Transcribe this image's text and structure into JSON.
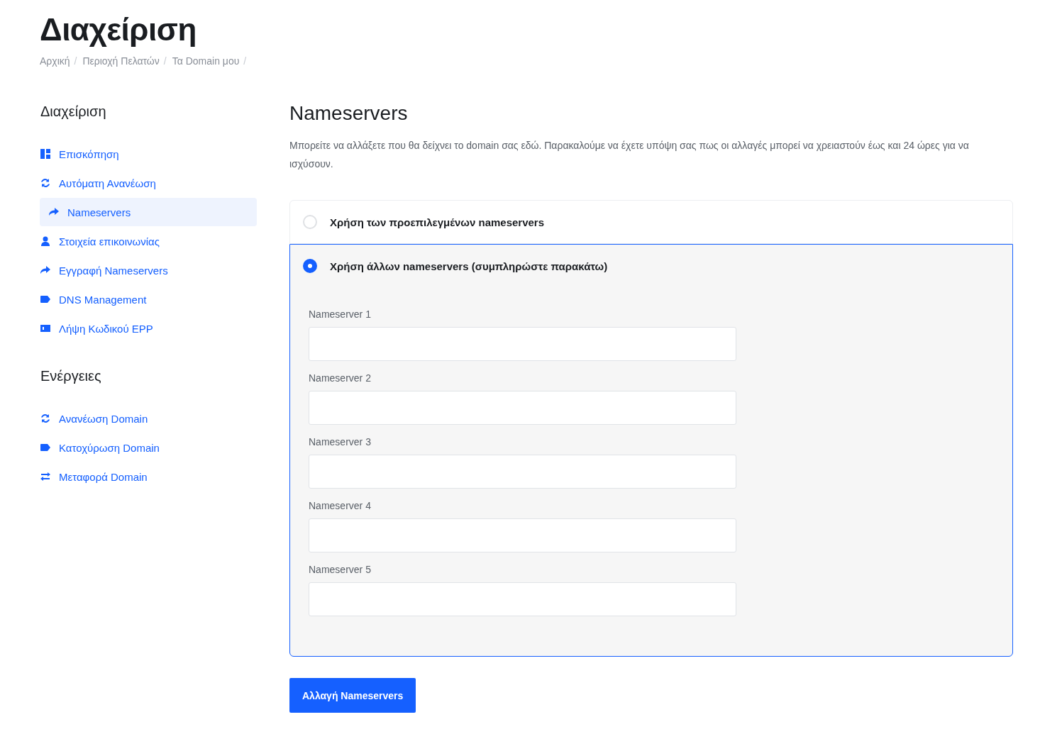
{
  "page_title": "Διαχείριση",
  "breadcrumb": [
    {
      "label": "Αρχική",
      "separator": "/"
    },
    {
      "label": "Περιοχή Πελατών",
      "separator": "/"
    },
    {
      "label": "Τα Domain μου",
      "separator": "/"
    }
  ],
  "sidebar": [
    {
      "heading": "Διαχείριση",
      "items": [
        {
          "label": "Επισκόπηση",
          "kind": "dashboard",
          "selected": false
        },
        {
          "label": "Αυτόματη Ανανέωση",
          "kind": "refresh",
          "selected": false
        },
        {
          "label": "Nameservers",
          "kind": "share",
          "selected": true
        },
        {
          "label": "Στοιχεία επικοινωνίας",
          "kind": "user",
          "selected": false
        },
        {
          "label": "Εγγραφή Nameservers",
          "kind": "share",
          "selected": false
        },
        {
          "label": "DNS Management",
          "kind": "tag",
          "selected": false
        },
        {
          "label": "Λήψη Κωδικού EPP",
          "kind": "card",
          "selected": false
        }
      ]
    },
    {
      "heading": "Ενέργειες",
      "items": [
        {
          "label": "Ανανέωση Domain",
          "kind": "refresh",
          "selected": false
        },
        {
          "label": "Κατοχύρωση Domain",
          "kind": "tag",
          "selected": false
        },
        {
          "label": "Μεταφορά Domain",
          "kind": "transfer",
          "selected": false
        }
      ]
    }
  ],
  "main": {
    "title": "Nameservers",
    "description": "Μπορείτε να αλλάξετε που θα δείχνει το domain σας εδώ. Παρακαλούμε να έχετε υπόψη σας πως οι αλλαγές μπορεί να χρειαστούν έως και 24 ώρες για να ισχύσουν.",
    "options": [
      {
        "label": "Χρήση των προεπιλεγμένων nameservers",
        "selected": false
      },
      {
        "label": "Χρήση άλλων nameservers (συμπληρώστε παρακάτω)",
        "selected": true,
        "fields": [
          {
            "label": "Nameserver 1"
          },
          {
            "label": "Nameserver 2"
          },
          {
            "label": "Nameserver 3"
          },
          {
            "label": "Nameserver 4"
          },
          {
            "label": "Nameserver 5"
          }
        ]
      }
    ],
    "submit": "Αλλαγή Nameservers"
  }
}
